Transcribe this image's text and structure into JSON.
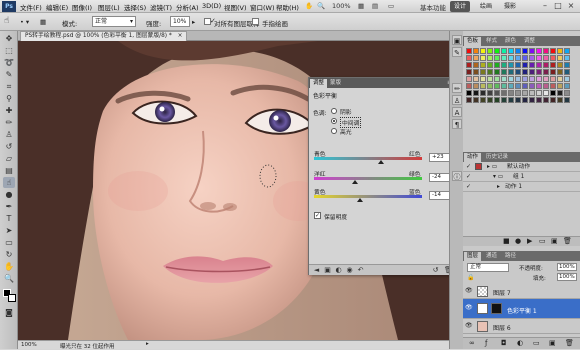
{
  "menubar": {
    "app_logo": "Ps",
    "items": [
      "文件(F)",
      "编辑(E)",
      "图像(I)",
      "图层(L)",
      "选择(S)",
      "滤镜(T)",
      "分析(A)",
      "3D(D)",
      "视图(V)",
      "窗口(W)",
      "帮助(H)"
    ],
    "zoom": "100%",
    "workspace": "基本功能",
    "ws_tabs": [
      "设计",
      "绘画",
      "摄影"
    ],
    "win_controls": [
      "–",
      "□",
      "×"
    ]
  },
  "options": {
    "mode_label": "模式:",
    "mode_value": "正常",
    "strength_label": "强度:",
    "strength_value": "10%",
    "sample_all_layers": "对所有图层取样",
    "finger_painting": "手指绘画"
  },
  "document": {
    "tab_title": "PS转手绘教程.psd @ 100% (色彩平衡 1, 图层蒙版/8) *",
    "status_zoom": "100%",
    "status_info": "曝光只在 32 位起作用"
  },
  "dialog": {
    "tabs": [
      "调整",
      "蒙版"
    ],
    "title": "色彩平衡",
    "tone_label": "色调:",
    "tones": [
      "阴影",
      "中间调",
      "高光"
    ],
    "tone_selected": 1,
    "sliders": [
      {
        "left": "青色",
        "right": "红色",
        "value": "+23",
        "fraction": 0.62
      },
      {
        "left": "洋红",
        "right": "绿色",
        "value": "-24",
        "fraction": 0.38
      },
      {
        "left": "黄色",
        "right": "蓝色",
        "value": "-14",
        "fraction": 0.43
      }
    ],
    "preserve_luminosity": "保留明度"
  },
  "panels": {
    "swatch_tabs": [
      "色板",
      "样式",
      "颜色",
      "调整"
    ],
    "actions_tabs": [
      "动作",
      "历史记录"
    ],
    "actions": [
      "默认动作",
      "组 1",
      "动作 1"
    ],
    "layers_tabs": [
      "图层",
      "通道",
      "路径"
    ],
    "blend_mode": "正常",
    "opacity_label": "不透明度:",
    "opacity_value": "100%",
    "fill_label": "填充:",
    "fill_value": "100%",
    "layers": [
      "图层 7",
      "色彩平衡 1",
      "图层 6"
    ],
    "selected_layer": 1
  },
  "colors": {
    "accent_blue": "#3a6ec8",
    "panel_gray": "#c9c9c9"
  }
}
